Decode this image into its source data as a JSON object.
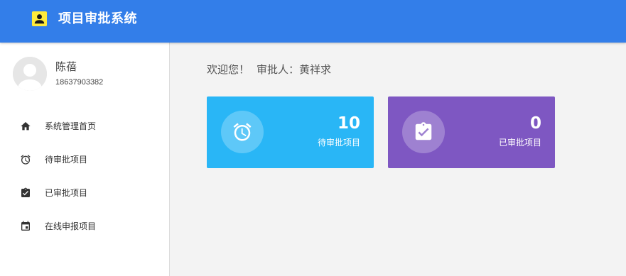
{
  "header": {
    "title": "项目审批系统",
    "logo_icon": "user-badge-icon",
    "background": "#337ee9",
    "logo_color": "#ffeb3b"
  },
  "user": {
    "name": "陈蓓",
    "phone": "18637903382",
    "avatar_icon": "default-avatar-icon"
  },
  "sidebar": {
    "items": [
      {
        "label": "系统管理首页",
        "icon": "home-icon"
      },
      {
        "label": "待审批项目",
        "icon": "alarm-clock-icon"
      },
      {
        "label": "已审批项目",
        "icon": "clipboard-check-icon"
      },
      {
        "label": "在线申报项目",
        "icon": "calendar-icon"
      }
    ]
  },
  "main": {
    "welcome": "欢迎您！",
    "approver": "审批人：黄祥求",
    "cards": [
      {
        "count": "10",
        "label": "待审批项目",
        "icon": "alarm-clock-icon",
        "color": "#29b6f6"
      },
      {
        "count": "0",
        "label": "已审批项目",
        "icon": "clipboard-check-icon",
        "color": "#7e57c2"
      }
    ]
  }
}
